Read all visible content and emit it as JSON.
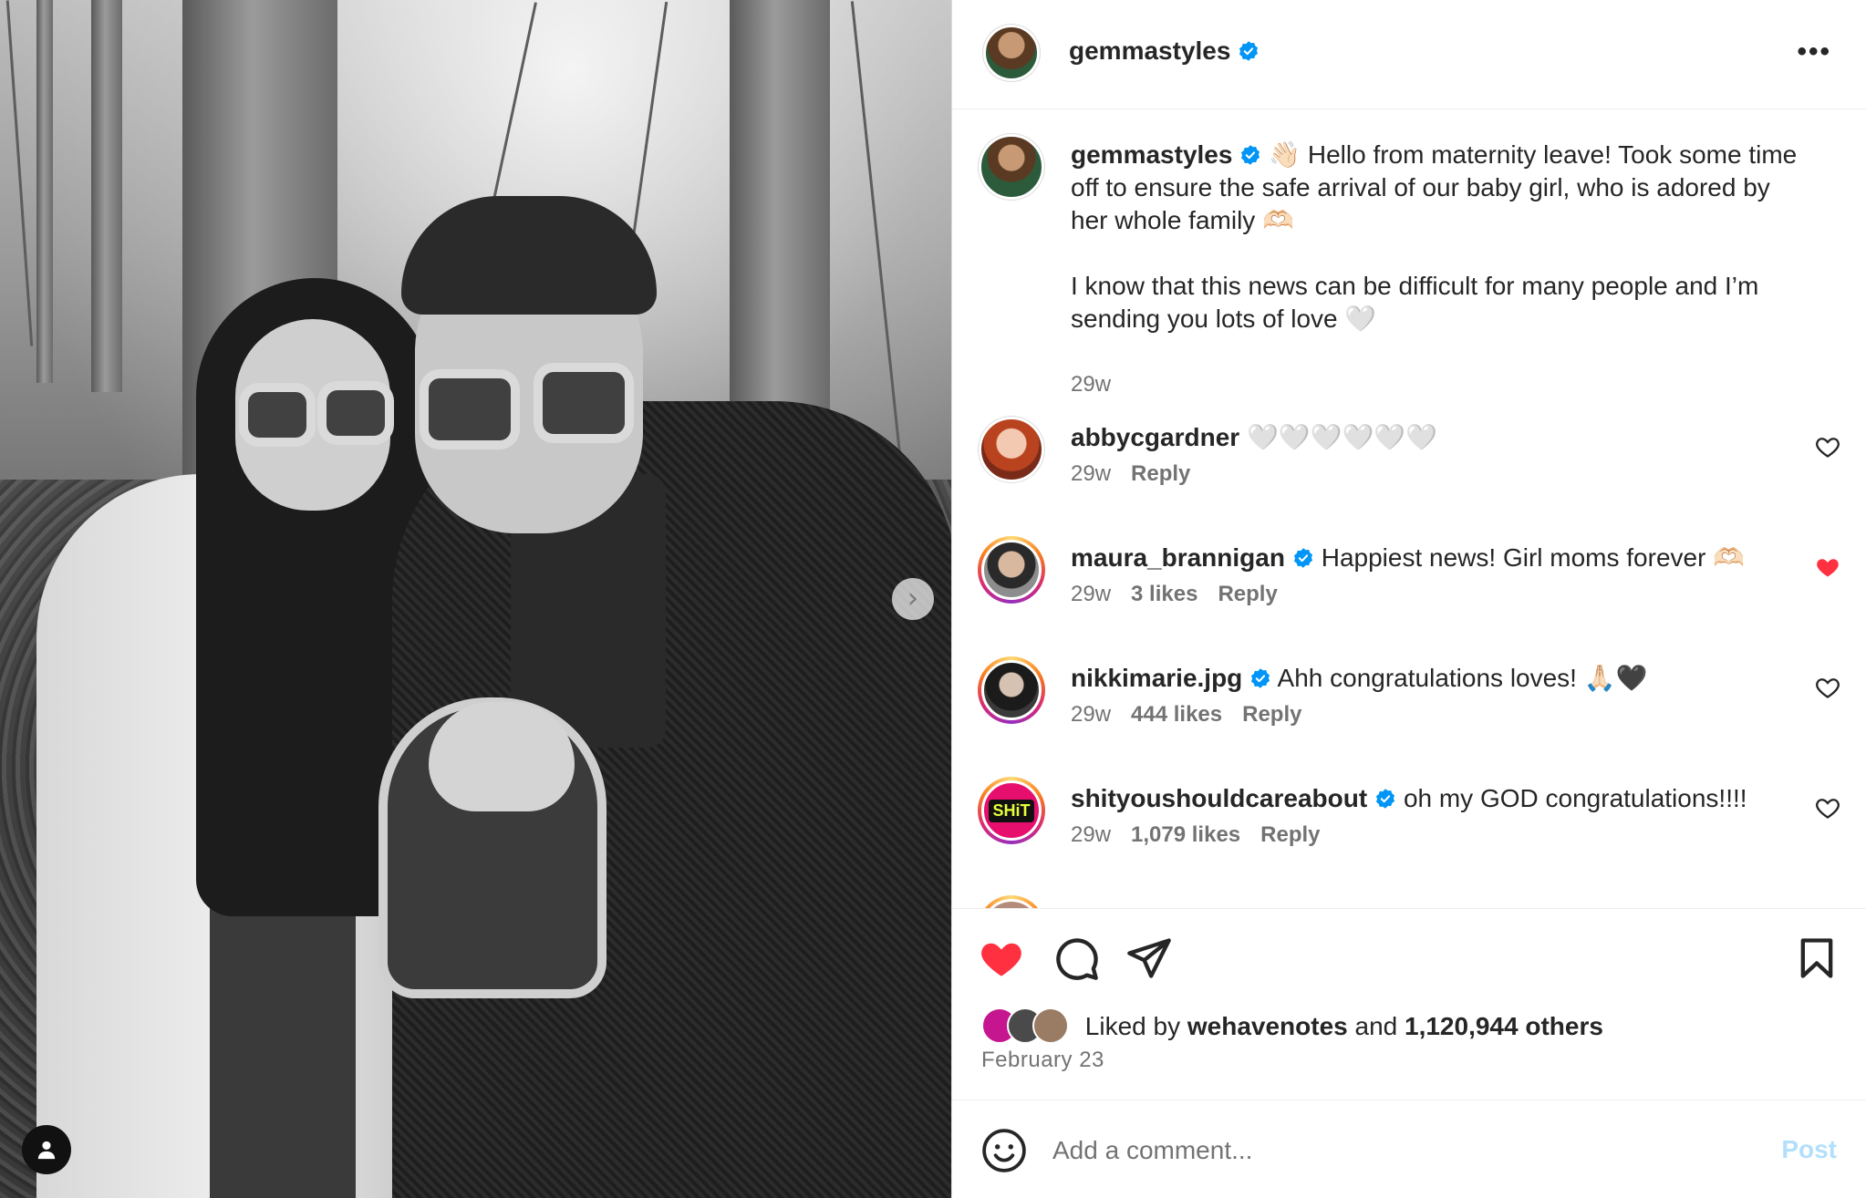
{
  "post": {
    "author": "gemmastyles",
    "more_icon": "more-horizontal-icon",
    "caption_line1": "👋🏻 Hello from maternity leave! Took some time off to ensure the safe arrival of our baby girl, who is adored by her whole family 🫶🏻",
    "caption_line2": "I know that this news can be difficult for many people and I’m sending you lots of love 🤍",
    "caption_time": "29w"
  },
  "comments": [
    {
      "user": "abbycgardner",
      "verified": false,
      "text": "🤍🤍🤍🤍🤍🤍",
      "time": "29w",
      "likes": "",
      "reply": "Reply",
      "liked": false
    },
    {
      "user": "maura_brannigan",
      "verified": true,
      "text": "Happiest news! Girl moms forever 🫶🏻",
      "time": "29w",
      "likes": "3 likes",
      "reply": "Reply",
      "liked": true
    },
    {
      "user": "nikkimarie.jpg",
      "verified": true,
      "text": "Ahh congratulations loves! 🙏🏻🖤",
      "time": "29w",
      "likes": "444 likes",
      "reply": "Reply",
      "liked": false
    },
    {
      "user": "shityoushouldcareabout",
      "verified": true,
      "text": "oh my GOD congratulations!!!!",
      "time": "29w",
      "likes": "1,079 likes",
      "reply": "Reply",
      "liked": false,
      "avatar_text": "SHiT"
    }
  ],
  "actions": {
    "liked": true,
    "icons": [
      "heart-filled-icon",
      "comment-icon",
      "share-icon",
      "bookmark-icon"
    ]
  },
  "likes": {
    "prefix": "Liked by",
    "first_liker": "wehavenotes",
    "conj": "and",
    "others": "1,120,944 others"
  },
  "date": "February 23",
  "comment_box": {
    "placeholder": "Add a comment...",
    "post_label": "Post"
  },
  "colors": {
    "verified_blue": "#0095f6",
    "like_red": "#ff3040",
    "post_disabled": "#b2dffc"
  }
}
